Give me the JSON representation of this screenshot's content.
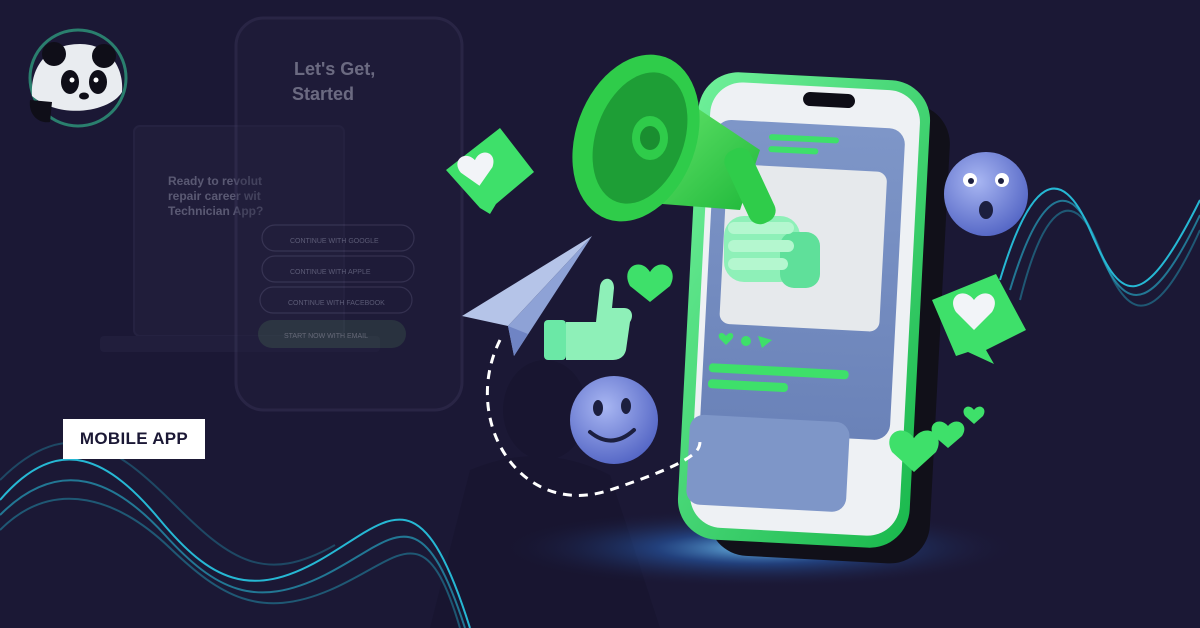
{
  "banner": {
    "badge_label": "MOBILE APP"
  },
  "background_phone_mockup": {
    "heading_line1": "Let's Get,",
    "heading_line2": "Started",
    "buttons": [
      "CONTINUE WITH GOOGLE",
      "CONTINUE WITH APPLE",
      "CONTINUE WITH FACEBOOK",
      "START NOW WITH EMAIL"
    ]
  },
  "background_laptop_mockup": {
    "headline_lines": [
      "Ready to revolut",
      "repair career wit",
      "Technician App?"
    ]
  },
  "brand": {
    "logo_icon": "panda-icon"
  },
  "colors": {
    "background": "#1b1835",
    "accent_green": "#3ee06a",
    "neon_cyan": "#29d4f0",
    "emoji_purple": "#6f7fd8",
    "badge_bg": "#ffffff"
  },
  "icons": [
    "megaphone-icon",
    "heart-icon",
    "thumbs-up-icon",
    "paper-plane-icon",
    "smiley-icon",
    "surprised-icon"
  ]
}
